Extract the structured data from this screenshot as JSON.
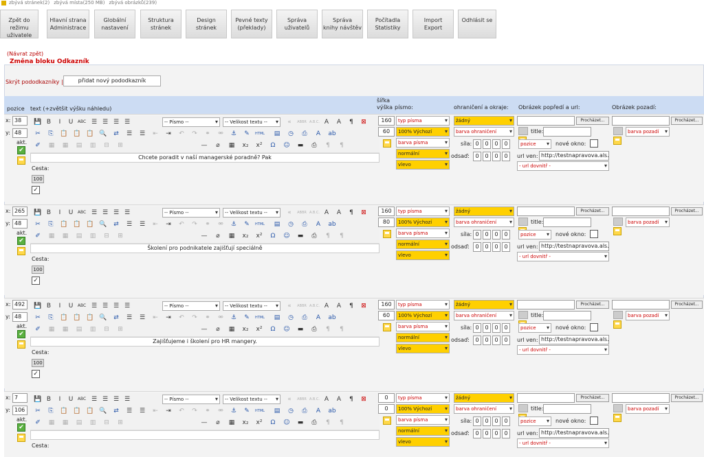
{
  "topbar": {
    "pages": "zbývá stránek(2)",
    "space": "zbývá místa(250 MB)",
    "images": "zbývá obrázků(239)"
  },
  "nav": [
    {
      "label": "Zpět do režimu\nuživatele"
    },
    {
      "label": "Hlavní strana\nAdministrace"
    },
    {
      "label": "Globální\nnastavení"
    },
    {
      "label": "Struktura\nstránek"
    },
    {
      "label": "Design\nstránek"
    },
    {
      "label": "Pevné texty\n(překlady)"
    },
    {
      "label": "Správa\nuživatelů"
    },
    {
      "label": "Správa\nknihy návštěv"
    },
    {
      "label": "Počítadla\nStatistiky"
    },
    {
      "label": "Import\nExport"
    },
    {
      "label": "Odhlásit se"
    }
  ],
  "back_link": "(Návrat zpět)",
  "section_title": "Změna bloku Odkazník",
  "hide_label": "Skrýt pododkazníky |",
  "add_button": "přidat nový pododkazník",
  "headers": {
    "pozice": "pozice",
    "text": "text (+zvětšit výšku náhledu)",
    "sirka": "šířka",
    "vyska": "výška",
    "pismo": "písmo:",
    "ohraniceni": "ohraničení a okraje:",
    "obrazek_popredi": "Obrázek popředí a url:",
    "obrazek_pozadi": "Obrázek pozadí:"
  },
  "labels": {
    "akt": "akt.",
    "cesta": "Cesta:",
    "sila": "síla:",
    "odsad": "odsaď:",
    "title": "title:",
    "nove_okno": "nové okno:",
    "url_ven": "url ven:",
    "prochazet": "Procházet...",
    "pismo_select": "-- Písmo --",
    "velikost_select": "-- Velikost textu --",
    "url_dovnitr": "- url dovnitř -",
    "pozice_select": "pozice",
    "barva_pozadi": "barva pozadí"
  },
  "rows": [
    {
      "x": "38",
      "y": "48",
      "width": "160",
      "height": "60",
      "text": "Chcete poradit v naší managerské poradně? Pak",
      "value100": "100",
      "url": "http://testnapravova.als.c",
      "typ": "typ písma",
      "size": "100% Výchozí",
      "barva": "barva písma",
      "weight": "normální",
      "align": "vlevo",
      "border": "žádný",
      "border_color": "barva ohraničení",
      "sila": [
        "0",
        "0",
        "0",
        "0"
      ],
      "odsad": [
        "0",
        "0",
        "0",
        "0"
      ]
    },
    {
      "x": "265",
      "y": "48",
      "width": "160",
      "height": "80",
      "text": "Školení pro podnikatele zajišťují speciálně",
      "value100": "100",
      "url": "http://testnapravova.als.c",
      "typ": "typ písma",
      "size": "100% Výchozí",
      "barva": "barva písma",
      "weight": "normální",
      "align": "vlevo",
      "border": "žádný",
      "border_color": "barva ohraničení",
      "sila": [
        "0",
        "0",
        "0",
        "0"
      ],
      "odsad": [
        "0",
        "0",
        "0",
        "0"
      ]
    },
    {
      "x": "492",
      "y": "48",
      "width": "160",
      "height": "60",
      "text": "Zajišťujeme i školení pro HR mangery.",
      "value100": "100",
      "url": "http://testnapravova.als.c",
      "typ": "typ písma",
      "size": "100% Výchozí",
      "barva": "barva písma",
      "weight": "normální",
      "align": "vlevo",
      "border": "žádný",
      "border_color": "barva ohraničení",
      "sila": [
        "0",
        "0",
        "0",
        "0"
      ],
      "odsad": [
        "0",
        "0",
        "0",
        "0"
      ]
    },
    {
      "x": "7",
      "y": "106",
      "width": "0",
      "height": "0",
      "text": "",
      "value100": "",
      "url": "http://testnapravova.als.c",
      "typ": "typ písma",
      "size": "100% Výchozí",
      "barva": "barva písma",
      "weight": "normální",
      "align": "vlevo",
      "border": "žádný",
      "border_color": "barva ohraničení",
      "sila": [
        "0",
        "0",
        "0",
        "0"
      ],
      "odsad": [
        "0",
        "0",
        "0",
        "0"
      ]
    }
  ]
}
